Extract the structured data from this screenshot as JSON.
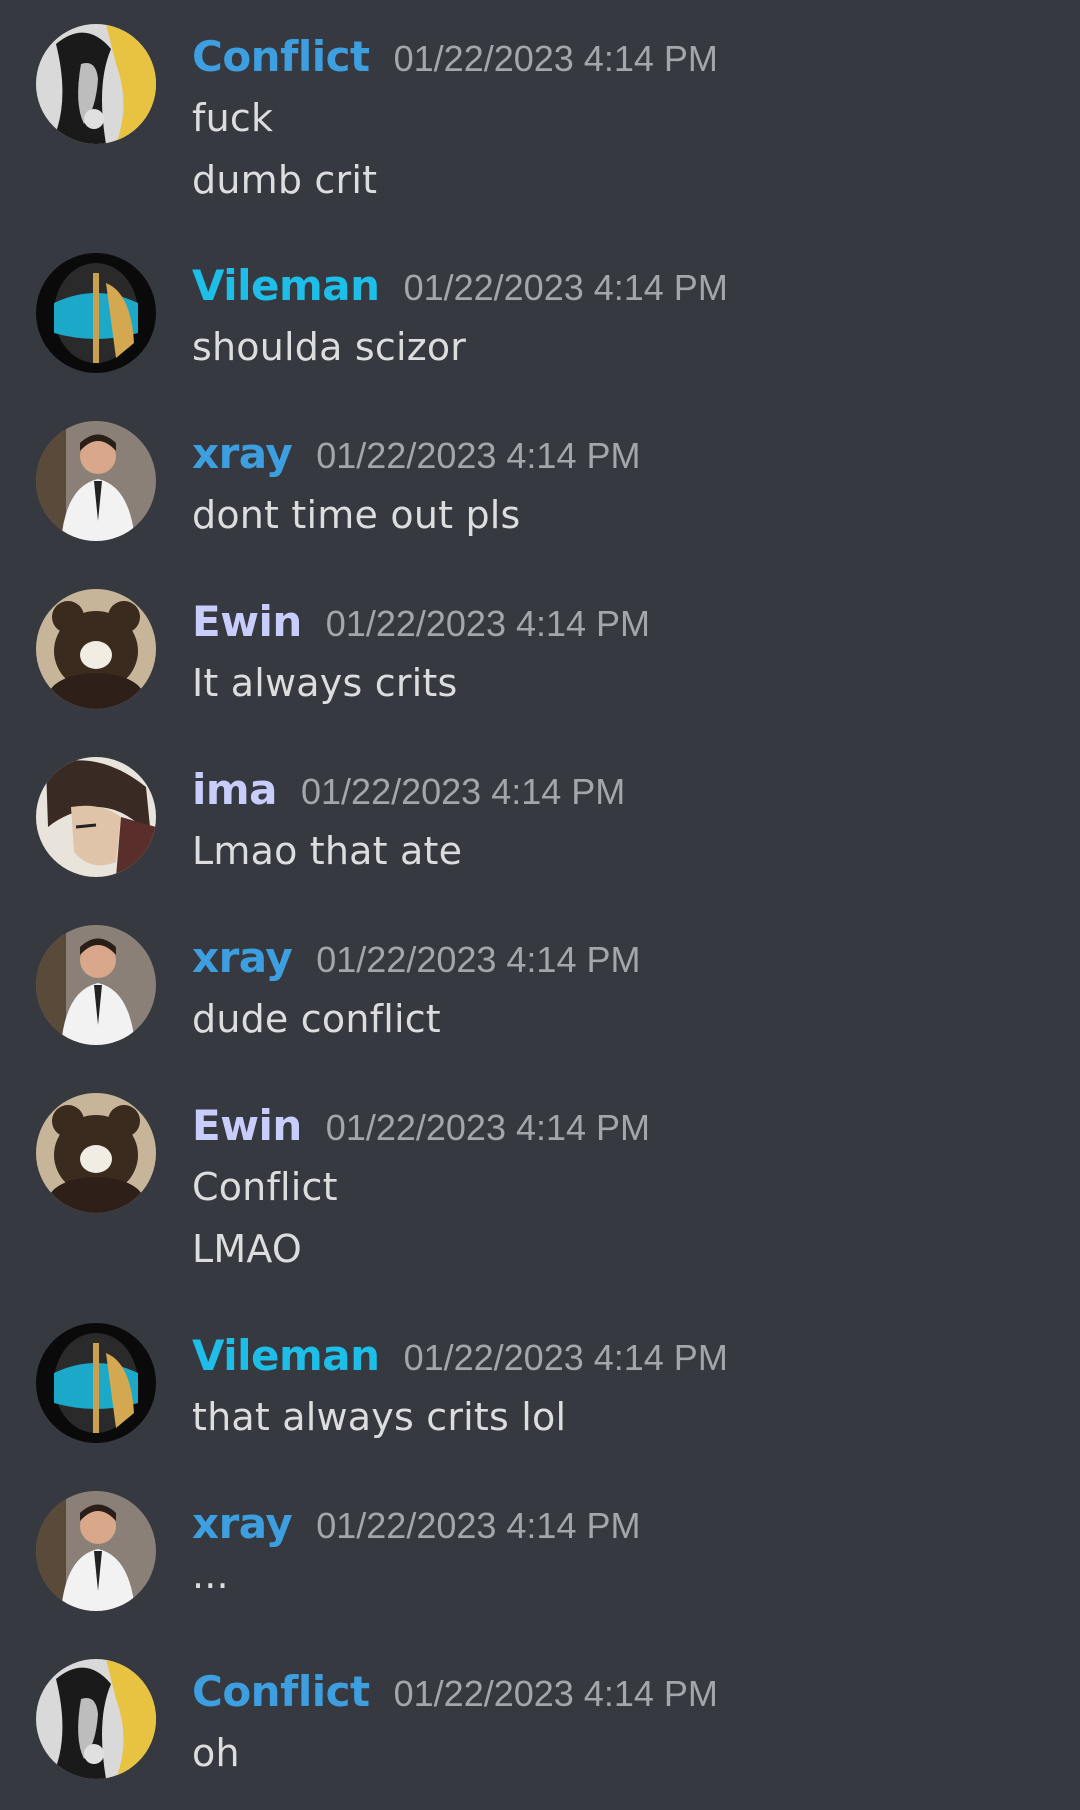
{
  "colors": {
    "background": "#36393f",
    "text": "#dcddde",
    "timestamp": "#a3a6aa"
  },
  "messages": [
    {
      "user": "Conflict",
      "color": "#3e9fe0",
      "avatar": "conflict-avatar",
      "time": "01/22/2023 4:14 PM",
      "lines": [
        "fuck",
        "dumb crit"
      ]
    },
    {
      "user": "Vileman",
      "color": "#1dbfe8",
      "avatar": "vileman-avatar",
      "time": "01/22/2023 4:14 PM",
      "lines": [
        "shoulda scizor"
      ]
    },
    {
      "user": "xray",
      "color": "#3e9fe0",
      "avatar": "xray-avatar",
      "time": "01/22/2023 4:14 PM",
      "lines": [
        "dont time out pls"
      ]
    },
    {
      "user": "Ewin",
      "color": "#c9cdfb",
      "avatar": "ewin-avatar",
      "time": "01/22/2023 4:14 PM",
      "lines": [
        "It always crits"
      ]
    },
    {
      "user": "ima",
      "color": "#c9cdfb",
      "avatar": "ima-avatar",
      "time": "01/22/2023 4:14 PM",
      "lines": [
        "Lmao that ate"
      ]
    },
    {
      "user": "xray",
      "color": "#3e9fe0",
      "avatar": "xray-avatar",
      "time": "01/22/2023 4:14 PM",
      "lines": [
        "dude conflict"
      ]
    },
    {
      "user": "Ewin",
      "color": "#c9cdfb",
      "avatar": "ewin-avatar",
      "time": "01/22/2023 4:14 PM",
      "lines": [
        "Conflict",
        "LMAO"
      ]
    },
    {
      "user": "Vileman",
      "color": "#1dbfe8",
      "avatar": "vileman-avatar",
      "time": "01/22/2023 4:14 PM",
      "lines": [
        "that always crits lol"
      ]
    },
    {
      "user": "xray",
      "color": "#3e9fe0",
      "avatar": "xray-avatar",
      "time": "01/22/2023 4:14 PM",
      "lines": [
        "..."
      ]
    },
    {
      "user": "Conflict",
      "color": "#3e9fe0",
      "avatar": "conflict-avatar",
      "time": "01/22/2023 4:14 PM",
      "lines": [
        "oh"
      ]
    }
  ]
}
